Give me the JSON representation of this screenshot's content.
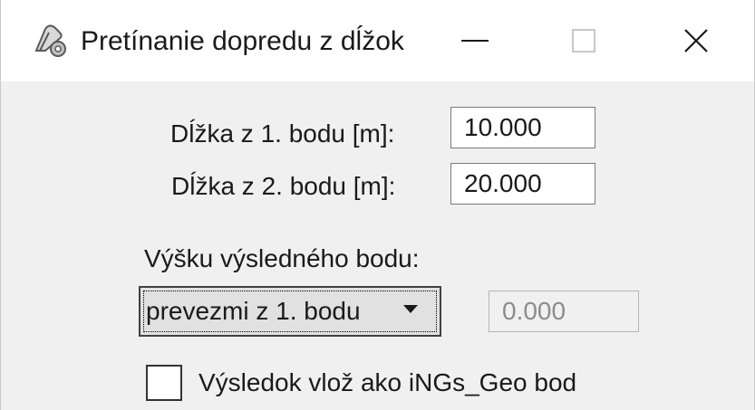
{
  "window": {
    "title": "Pretínanie dopredu z dĺžok",
    "app_icon": "compass-tool-icon",
    "controls": [
      "minimize-icon",
      "maximize-icon",
      "close-icon"
    ]
  },
  "form": {
    "length1_label": "Dĺžka  z  1. bodu [m]:",
    "length1_value": "10.000",
    "length2_label": "Dĺžka  z  2. bodu [m]:",
    "length2_value": "20.000",
    "height_label": "Výšku výsledného bodu:",
    "height_source_selected": "prevezmi z 1. bodu",
    "height_value": "0.000",
    "insert_checkbox_label": "Výsledok vlož ako iNGs_Geo bod",
    "insert_checkbox_checked": false
  }
}
